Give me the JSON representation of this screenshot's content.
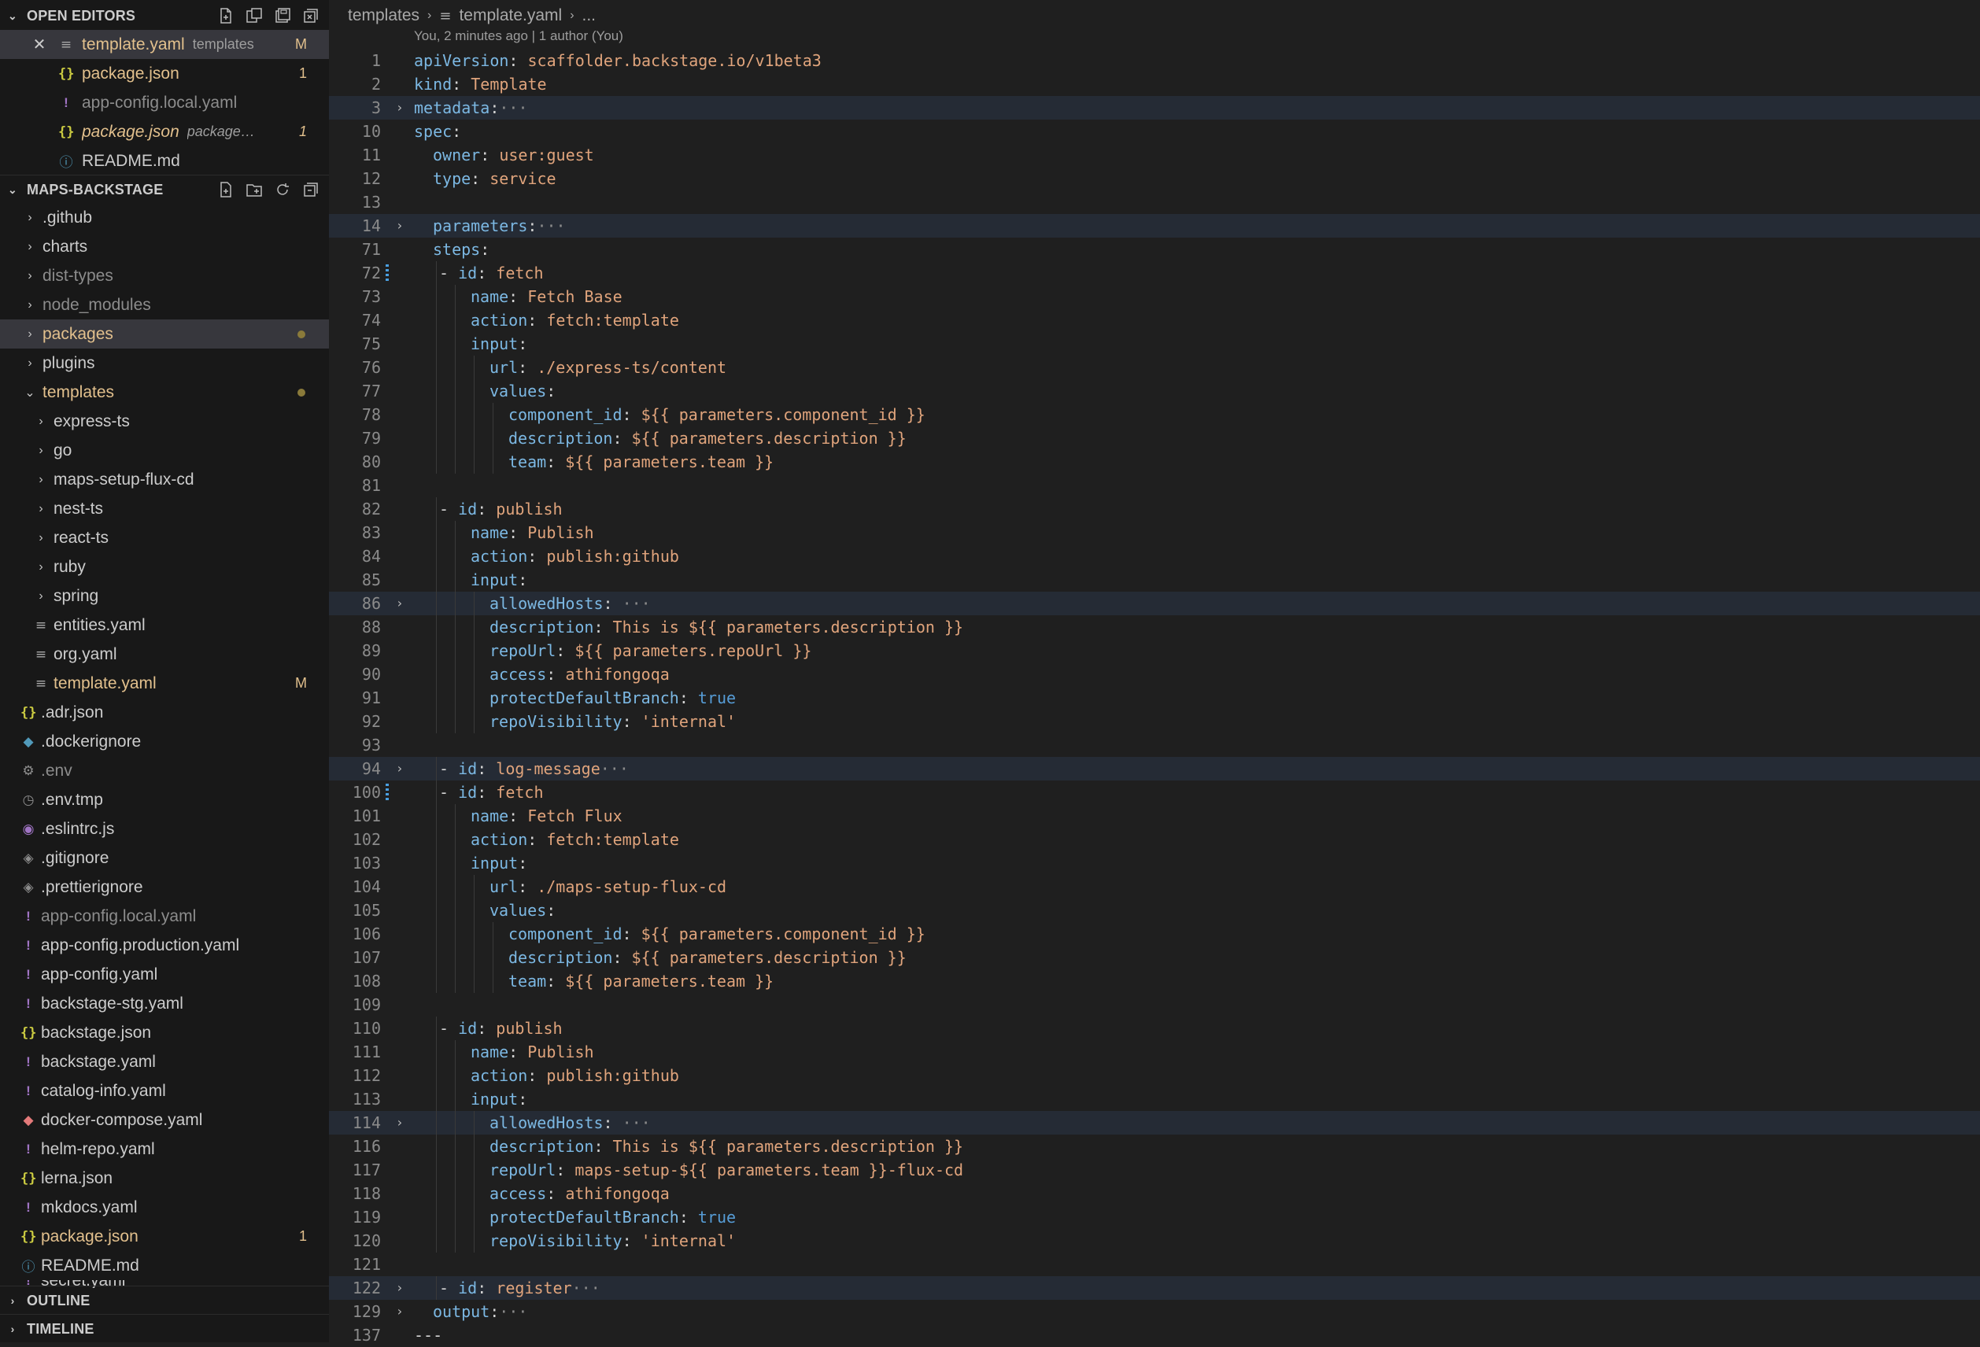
{
  "sidebar": {
    "open_editors": {
      "title": "OPEN EDITORS",
      "items": [
        {
          "name": "template.yaml",
          "desc": "templates",
          "badge": "M"
        },
        {
          "name": "package.json",
          "desc": "",
          "badge": "1"
        },
        {
          "name": "app-config.local.yaml",
          "desc": "",
          "badge": ""
        },
        {
          "name": "package.json",
          "desc": "packages/...",
          "badge": "1"
        },
        {
          "name": "README.md",
          "desc": "",
          "badge": ""
        }
      ]
    },
    "explorer": {
      "title": "MAPS-BACKSTAGE",
      "items": [
        ".github",
        "charts",
        "dist-types",
        "node_modules",
        "packages",
        "plugins",
        "templates",
        "express-ts",
        "go",
        "maps-setup-flux-cd",
        "nest-ts",
        "react-ts",
        "ruby",
        "spring",
        "entities.yaml",
        "org.yaml",
        "template.yaml",
        ".adr.json",
        ".dockerignore",
        ".env",
        ".env.tmp",
        ".eslintrc.js",
        ".gitignore",
        ".prettierignore",
        "app-config.local.yaml",
        "app-config.production.yaml",
        "app-config.yaml",
        "backstage-stg.yaml",
        "backstage.json",
        "backstage.yaml",
        "catalog-info.yaml",
        "docker-compose.yaml",
        "helm-repo.yaml",
        "lerna.json",
        "mkdocs.yaml",
        "package.json",
        "README.md",
        "secret.yaml"
      ],
      "badges": {
        "template_yaml": "M",
        "package_json": "1"
      }
    },
    "outline": {
      "title": "OUTLINE"
    },
    "timeline": {
      "title": "TIMELINE"
    }
  },
  "editor": {
    "breadcrumb": [
      "templates",
      "template.yaml",
      "..."
    ],
    "blame": "You, 2 minutes ago | 1 author (You)",
    "lines": [
      {
        "n": "1",
        "key": "apiVersion",
        "val": "scaffolder.backstage.io/v1beta3"
      },
      {
        "n": "2",
        "key": "kind",
        "val": "Template"
      },
      {
        "n": "3",
        "key": "metadata",
        "val": ""
      },
      {
        "n": "10",
        "key": "spec",
        "val": ""
      },
      {
        "n": "11",
        "key": "owner",
        "val": "user:guest"
      },
      {
        "n": "12",
        "key": "type",
        "val": "service"
      },
      {
        "n": "13",
        "key": "",
        "val": ""
      },
      {
        "n": "14",
        "key": "parameters",
        "val": ""
      },
      {
        "n": "71",
        "key": "steps",
        "val": ""
      },
      {
        "n": "72",
        "key": "id",
        "val": "fetch"
      },
      {
        "n": "73",
        "key": "name",
        "val": "Fetch Base"
      },
      {
        "n": "74",
        "key": "action",
        "val": "fetch:template"
      },
      {
        "n": "75",
        "key": "input",
        "val": ""
      },
      {
        "n": "76",
        "key": "url",
        "val": "./express-ts/content"
      },
      {
        "n": "77",
        "key": "values",
        "val": ""
      },
      {
        "n": "78",
        "key": "component_id",
        "val": "${{ parameters.component_id }}"
      },
      {
        "n": "79",
        "key": "description",
        "val": "${{ parameters.description }}"
      },
      {
        "n": "80",
        "key": "team",
        "val": "${{ parameters.team }}"
      },
      {
        "n": "81",
        "key": "",
        "val": ""
      },
      {
        "n": "82",
        "key": "id",
        "val": "publish"
      },
      {
        "n": "83",
        "key": "name",
        "val": "Publish"
      },
      {
        "n": "84",
        "key": "action",
        "val": "publish:github"
      },
      {
        "n": "85",
        "key": "input",
        "val": ""
      },
      {
        "n": "86",
        "key": "allowedHosts",
        "val": ""
      },
      {
        "n": "88",
        "key": "description",
        "val": "This is ${{ parameters.description }}"
      },
      {
        "n": "89",
        "key": "repoUrl",
        "val": "${{ parameters.repoUrl }}"
      },
      {
        "n": "90",
        "key": "access",
        "val": "athifongoqa"
      },
      {
        "n": "91",
        "key": "protectDefaultBranch",
        "val": "true"
      },
      {
        "n": "92",
        "key": "repoVisibility",
        "val": "'internal'"
      },
      {
        "n": "93",
        "key": "",
        "val": ""
      },
      {
        "n": "94",
        "key": "id",
        "val": "log-message"
      },
      {
        "n": "100",
        "key": "id",
        "val": "fetch"
      },
      {
        "n": "101",
        "key": "name",
        "val": "Fetch Flux"
      },
      {
        "n": "102",
        "key": "action",
        "val": "fetch:template"
      },
      {
        "n": "103",
        "key": "input",
        "val": ""
      },
      {
        "n": "104",
        "key": "url",
        "val": "./maps-setup-flux-cd"
      },
      {
        "n": "105",
        "key": "values",
        "val": ""
      },
      {
        "n": "106",
        "key": "component_id",
        "val": "${{ parameters.component_id }}"
      },
      {
        "n": "107",
        "key": "description",
        "val": "${{ parameters.description }}"
      },
      {
        "n": "108",
        "key": "team",
        "val": "${{ parameters.team }}"
      },
      {
        "n": "109",
        "key": "",
        "val": ""
      },
      {
        "n": "110",
        "key": "id",
        "val": "publish"
      },
      {
        "n": "111",
        "key": "name",
        "val": "Publish"
      },
      {
        "n": "112",
        "key": "action",
        "val": "publish:github"
      },
      {
        "n": "113",
        "key": "input",
        "val": ""
      },
      {
        "n": "114",
        "key": "allowedHosts",
        "val": ""
      },
      {
        "n": "116",
        "key": "description",
        "val": "This is ${{ parameters.description }}"
      },
      {
        "n": "117",
        "key": "repoUrl",
        "val": "maps-setup-${{ parameters.team }}-flux-cd"
      },
      {
        "n": "118",
        "key": "access",
        "val": "athifongoqa"
      },
      {
        "n": "119",
        "key": "protectDefaultBranch",
        "val": "true"
      },
      {
        "n": "120",
        "key": "repoVisibility",
        "val": "'internal'"
      },
      {
        "n": "121",
        "key": "",
        "val": ""
      },
      {
        "n": "122",
        "key": "id",
        "val": "register"
      },
      {
        "n": "129",
        "key": "output",
        "val": ""
      },
      {
        "n": "137",
        "key": "",
        "val": "---"
      }
    ]
  }
}
